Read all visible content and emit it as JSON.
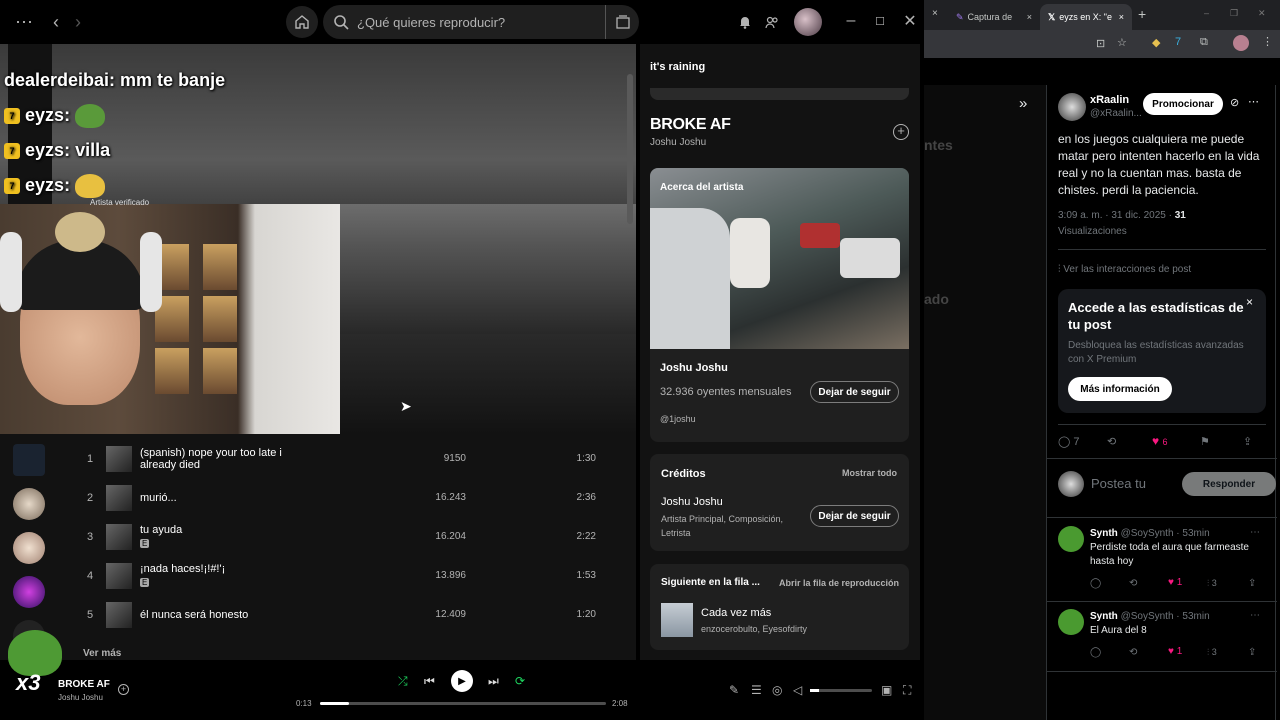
{
  "topbar": {
    "search_placeholder": "¿Qué quieres reproducir?",
    "notif_icon": "bell-icon"
  },
  "hero": {
    "verified_label": "Artista verificado"
  },
  "tracks": [
    {
      "num": "1",
      "title": "(spanish) nope your too late i already died",
      "plays": "9150",
      "dur": "1:30",
      "explicit": ""
    },
    {
      "num": "2",
      "title": "murió...",
      "plays": "16.243",
      "dur": "2:36",
      "explicit": ""
    },
    {
      "num": "3",
      "title": "tu ayuda",
      "plays": "16.204",
      "dur": "2:22",
      "explicit": "E"
    },
    {
      "num": "4",
      "title": "¡nada haces!¡!#!'¡",
      "plays": "13.896",
      "dur": "1:53",
      "explicit": "E"
    },
    {
      "num": "5",
      "title": "él nunca será honesto",
      "plays": "12.409",
      "dur": "1:20",
      "explicit": ""
    }
  ],
  "vermas": "Ver más",
  "right": {
    "playlist_title": "it's raining",
    "song_title": "BROKE AF",
    "song_artist": "Joshu Joshu",
    "about_label": "Acerca del artista",
    "artist_name": "Joshu Joshu",
    "listeners": "32.936 oyentes mensuales",
    "unfollow": "Dejar de seguir",
    "handle": "@1joshu",
    "credits_title": "Créditos",
    "show_all": "Mostrar todo",
    "credit_name": "Joshu Joshu",
    "credit_roles": "Artista Principal, Composición, Letrista",
    "credit_unfollow": "Dejar de seguir",
    "next_title": "Siguiente en la fila ...",
    "open_queue": "Abrir la fila de reproducción",
    "next_song": "Cada vez más",
    "next_artists": "enzocerobulto, Eyesofdirty"
  },
  "player": {
    "title": "BROKE AF",
    "artist": "Joshu Joshu",
    "elapsed": "0:13",
    "total": "2:08",
    "progress": 0.1,
    "volume": 0.15
  },
  "chat": [
    {
      "user": "dealerdeibai",
      "msg": "mm te banje"
    },
    {
      "user": "eyzs",
      "msg": ""
    },
    {
      "user": "eyzs",
      "msg": "villa"
    },
    {
      "user": "eyzs",
      "msg": ""
    }
  ],
  "stream": {
    "emote_count": "x3"
  },
  "browser": {
    "tab1": "Captura de",
    "tab2": "eyzs en X: \"e",
    "close": "×"
  },
  "tweet": {
    "author": "xRaalin",
    "handle": "@xRaalin...",
    "promote": "Promocionar",
    "text": "en los juegos cualquiera me puede matar pero intenten hacerlo en la vida real y no la cuentan mas. basta de chistes. perdi la paciencia.",
    "time": "3:09 a. m. · 31 dic. 2025 · ",
    "views_count": "31",
    "views_label": "Visualizaciones",
    "interactions": "Ver las interacciones de post",
    "premium_title": "Accede a las estadísticas de tu post",
    "premium_body": "Desbloquea las estadísticas avanzadas con X Premium",
    "premium_btn": "Más información",
    "replies_count": "7",
    "likes_count": "6",
    "reply_placeholder": "Postea tu",
    "reply_btn": "Responder"
  },
  "replies": [
    {
      "name": "Synth",
      "handle": "@SoySynth · 53min",
      "text": "Perdiste toda el aura que farmeaste hasta hoy",
      "likes": "1",
      "views": "3"
    },
    {
      "name": "Synth",
      "handle": "@SoySynth · 53min",
      "text": "El Aura del 8",
      "likes": "1",
      "views": "3"
    }
  ],
  "tw_side": {
    "frag1": "ntes",
    "frag2": "ado"
  },
  "colors": {
    "spotify_green": "#1ed760",
    "x_pink": "#f91880",
    "panel": "#121212"
  }
}
